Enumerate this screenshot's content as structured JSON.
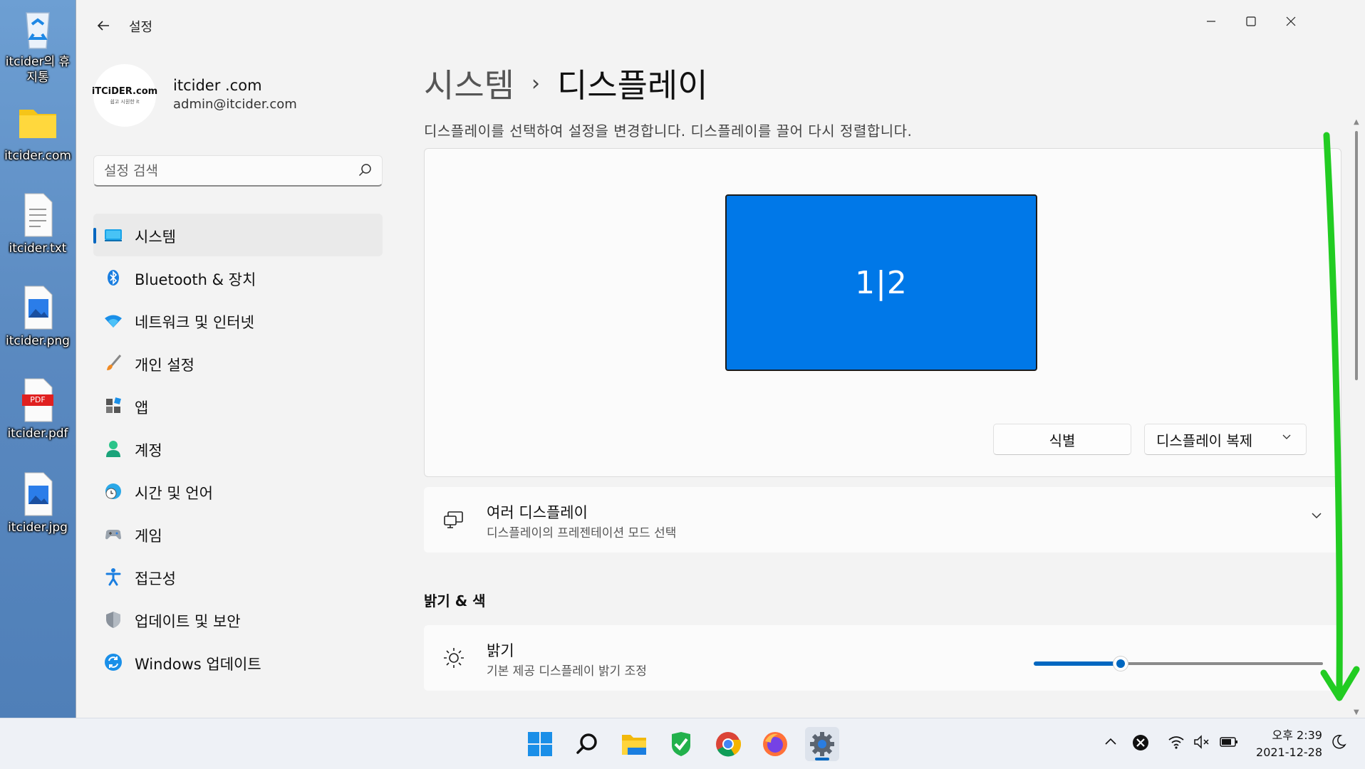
{
  "desktop": {
    "icons": [
      {
        "label": "itcider의 휴지통",
        "icon": "recycle-bin-icon"
      },
      {
        "label": "itcider.com",
        "icon": "folder-icon"
      },
      {
        "label": "itcider.txt",
        "icon": "text-file-icon"
      },
      {
        "label": "itcider.png",
        "icon": "image-file-icon"
      },
      {
        "label": "itcider.pdf",
        "icon": "pdf-file-icon",
        "badge": "PDF"
      },
      {
        "label": "itcider.jpg",
        "icon": "image-file-icon"
      }
    ]
  },
  "window": {
    "app_title": "설정",
    "controls": {
      "minimize": "—",
      "maximize": "☐",
      "close": "✕"
    }
  },
  "sidebar": {
    "profile": {
      "avatar_line1": "iTCiDER.com",
      "avatar_line2": "쉽고 시원한 it",
      "name": "itcider .com",
      "email": "admin@itcider.com"
    },
    "search": {
      "placeholder": "설정 검색"
    },
    "items": [
      {
        "label": "시스템",
        "icon": "system-icon",
        "active": true
      },
      {
        "label": "Bluetooth & 장치",
        "icon": "bluetooth-icon"
      },
      {
        "label": "네트워크 및 인터넷",
        "icon": "wifi-icon"
      },
      {
        "label": "개인 설정",
        "icon": "brush-icon"
      },
      {
        "label": "앱",
        "icon": "apps-icon"
      },
      {
        "label": "계정",
        "icon": "account-icon"
      },
      {
        "label": "시간 및 언어",
        "icon": "clock-globe-icon"
      },
      {
        "label": "게임",
        "icon": "gamepad-icon"
      },
      {
        "label": "접근성",
        "icon": "accessibility-icon"
      },
      {
        "label": "업데이트 및 보안",
        "icon": "shield-icon"
      },
      {
        "label": "Windows 업데이트",
        "icon": "update-icon"
      }
    ]
  },
  "main": {
    "breadcrumb": {
      "parent": "시스템",
      "separator": "›",
      "current": "디스플레이"
    },
    "description": "디스플레이를 선택하여 설정을 변경합니다. 디스플레이를 끌어 다시 정렬합니다.",
    "display_panel": {
      "monitor_label": "1|2",
      "identify_button": "식별",
      "duplicate_dropdown": "디스플레이 복제"
    },
    "multiple_displays": {
      "title": "여러 디스플레이",
      "subtitle": "디스플레이의 프레젠테이션 모드 선택"
    },
    "section_brightness_color": "밝기 & 색",
    "brightness": {
      "title": "밝기",
      "subtitle": "기본 제공 디스플레이 밝기 조정",
      "value_percent": 30
    }
  },
  "colors": {
    "accent": "#0067c0",
    "monitor": "#0078e8",
    "annotation": "#22cc22"
  },
  "taskbar": {
    "apps": [
      "start-icon",
      "search-icon",
      "file-explorer-icon",
      "checkmark-app-icon",
      "chrome-icon",
      "firefox-icon",
      "settings-icon"
    ],
    "clock": {
      "time": "오후 2:39",
      "date": "2021-12-28"
    }
  }
}
